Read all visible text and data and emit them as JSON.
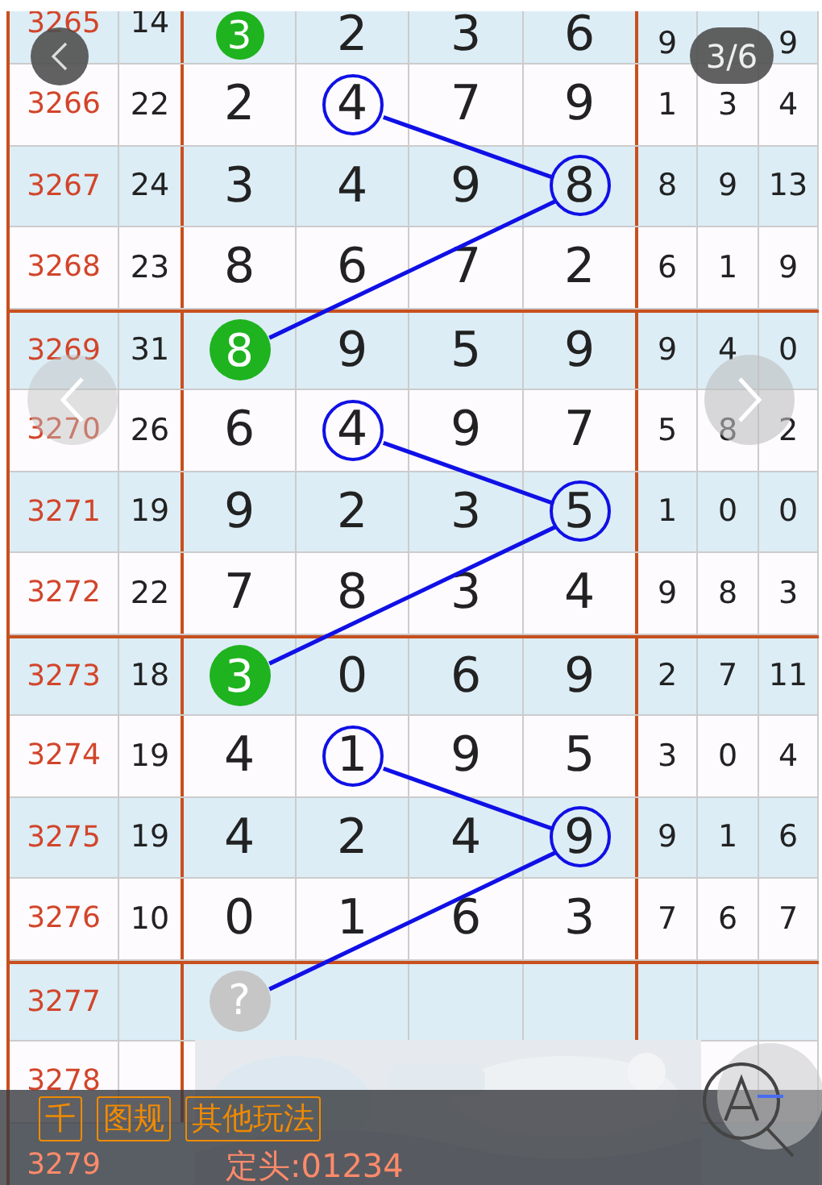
{
  "rows": [
    {
      "period": "3265",
      "sum": "14",
      "digits": [
        {
          "value": "3",
          "kind": "head"
        },
        {
          "value": "2",
          "kind": "plain"
        },
        {
          "value": "3",
          "kind": "plain"
        },
        {
          "value": "6",
          "kind": "plain"
        }
      ],
      "extras": {
        "column_1": "9",
        "column_3": "9"
      }
    },
    {
      "period": "3266",
      "sum": "22",
      "digits": [
        {
          "value": "2",
          "kind": "plain"
        },
        {
          "value": "4",
          "kind": "ring"
        },
        {
          "value": "7",
          "kind": "plain"
        },
        {
          "value": "9",
          "kind": "plain"
        }
      ],
      "extras": [
        "1",
        "3",
        "4"
      ]
    },
    {
      "period": "3267",
      "sum": "24",
      "digits": [
        {
          "value": "3",
          "kind": "plain"
        },
        {
          "value": "4",
          "kind": "plain"
        },
        {
          "value": "9",
          "kind": "plain"
        },
        {
          "value": "8",
          "kind": "ring"
        }
      ],
      "extras": [
        "8",
        "9",
        "13"
      ]
    },
    {
      "period": "3268",
      "sum": "23",
      "digits": [
        {
          "value": "8",
          "kind": "plain"
        },
        {
          "value": "6",
          "kind": "plain"
        },
        {
          "value": "7",
          "kind": "plain"
        },
        {
          "value": "2",
          "kind": "plain"
        }
      ],
      "extras": [
        "6",
        "1",
        "9"
      ]
    },
    {
      "period": "3269",
      "sum": "31",
      "digits": [
        {
          "value": "8",
          "kind": "head"
        },
        {
          "value": "9",
          "kind": "plain"
        },
        {
          "value": "5",
          "kind": "plain"
        },
        {
          "value": "9",
          "kind": "plain"
        }
      ],
      "extras": [
        "9",
        "4",
        "0"
      ]
    },
    {
      "period": "3270",
      "sum": "26",
      "digits": [
        {
          "value": "6",
          "kind": "plain"
        },
        {
          "value": "4",
          "kind": "ring"
        },
        {
          "value": "9",
          "kind": "plain"
        },
        {
          "value": "7",
          "kind": "plain"
        }
      ],
      "extras": [
        "5",
        "8",
        "2"
      ]
    },
    {
      "period": "3271",
      "sum": "19",
      "digits": [
        {
          "value": "9",
          "kind": "plain"
        },
        {
          "value": "2",
          "kind": "plain"
        },
        {
          "value": "3",
          "kind": "plain"
        },
        {
          "value": "5",
          "kind": "ring"
        }
      ],
      "extras": [
        "1",
        "0",
        "0"
      ]
    },
    {
      "period": "3272",
      "sum": "22",
      "digits": [
        {
          "value": "7",
          "kind": "plain"
        },
        {
          "value": "8",
          "kind": "plain"
        },
        {
          "value": "3",
          "kind": "plain"
        },
        {
          "value": "4",
          "kind": "plain"
        }
      ],
      "extras": [
        "9",
        "8",
        "3"
      ]
    },
    {
      "period": "3273",
      "sum": "18",
      "digits": [
        {
          "value": "3",
          "kind": "head"
        },
        {
          "value": "0",
          "kind": "plain"
        },
        {
          "value": "6",
          "kind": "plain"
        },
        {
          "value": "9",
          "kind": "plain"
        }
      ],
      "extras": [
        "2",
        "7",
        "11"
      ]
    },
    {
      "period": "3274",
      "sum": "19",
      "digits": [
        {
          "value": "4",
          "kind": "plain"
        },
        {
          "value": "1",
          "kind": "ring"
        },
        {
          "value": "9",
          "kind": "plain"
        },
        {
          "value": "5",
          "kind": "plain"
        }
      ],
      "extras": [
        "3",
        "0",
        "4"
      ]
    },
    {
      "period": "3275",
      "sum": "19",
      "digits": [
        {
          "value": "4",
          "kind": "plain"
        },
        {
          "value": "2",
          "kind": "plain"
        },
        {
          "value": "4",
          "kind": "plain"
        },
        {
          "value": "9",
          "kind": "ring"
        }
      ],
      "extras": [
        "9",
        "1",
        "6"
      ]
    },
    {
      "period": "3276",
      "sum": "10",
      "digits": [
        {
          "value": "0",
          "kind": "plain"
        },
        {
          "value": "1",
          "kind": "plain"
        },
        {
          "value": "6",
          "kind": "plain"
        },
        {
          "value": "3",
          "kind": "plain"
        }
      ],
      "extras": [
        "7",
        "6",
        "7"
      ]
    },
    {
      "period": "3277",
      "digits": [
        {
          "value": "?",
          "kind": "unknown"
        }
      ]
    },
    {
      "period": "3278"
    },
    {
      "period": "3279",
      "note": "定头:01234"
    }
  ],
  "viewer": {
    "counter": "3/6"
  },
  "toolbar": {
    "buttons": [
      "千",
      "图规",
      "其他玩法"
    ]
  }
}
